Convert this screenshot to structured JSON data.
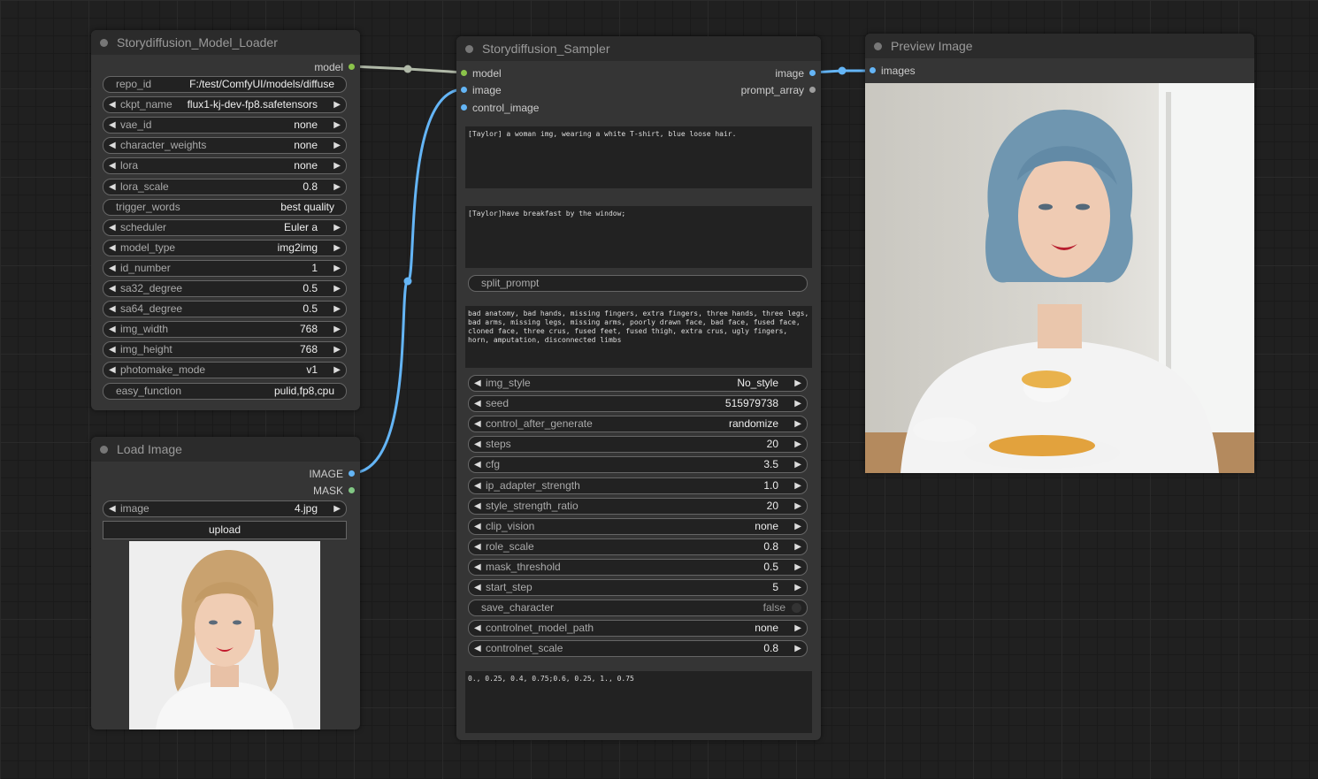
{
  "colors": {
    "canvas_bg": "#202020",
    "node_bg": "#353535",
    "node_title_bg": "#2b2b2b",
    "widget_bg": "#222222",
    "link_image": "#64b5f6",
    "link_model": "#b0b9a8",
    "slot_model": "#8bc34a",
    "slot_image": "#64b5f6",
    "slot_mask": "#81c784",
    "slot_string": "#9e9e9e"
  },
  "model_loader": {
    "title": "Storydiffusion_Model_Loader",
    "output": "model",
    "widgets": [
      {
        "label": "repo_id",
        "value": "F:/test/ComfyUI/models/diffuse",
        "kind": "text"
      },
      {
        "label": "ckpt_name",
        "value": "flux1-kj-dev-fp8.safetensors",
        "kind": "combo"
      },
      {
        "label": "vae_id",
        "value": "none",
        "kind": "combo"
      },
      {
        "label": "character_weights",
        "value": "none",
        "kind": "combo"
      },
      {
        "label": "lora",
        "value": "none",
        "kind": "combo"
      },
      {
        "label": "lora_scale",
        "value": "0.8",
        "kind": "combo"
      },
      {
        "label": "trigger_words",
        "value": "best quality",
        "kind": "text"
      },
      {
        "label": "scheduler",
        "value": "Euler a",
        "kind": "combo"
      },
      {
        "label": "model_type",
        "value": "img2img",
        "kind": "combo"
      },
      {
        "label": "id_number",
        "value": "1",
        "kind": "combo"
      },
      {
        "label": "sa32_degree",
        "value": "0.5",
        "kind": "combo"
      },
      {
        "label": "sa64_degree",
        "value": "0.5",
        "kind": "combo"
      },
      {
        "label": "img_width",
        "value": "768",
        "kind": "combo"
      },
      {
        "label": "img_height",
        "value": "768",
        "kind": "combo"
      },
      {
        "label": "photomake_mode",
        "value": "v1",
        "kind": "combo"
      },
      {
        "label": "easy_function",
        "value": "pulid,fp8,cpu",
        "kind": "text"
      }
    ]
  },
  "load_image": {
    "title": "Load Image",
    "outputs": [
      "IMAGE",
      "MASK"
    ],
    "image_widget": {
      "label": "image",
      "value": "4.jpg"
    },
    "upload_label": "upload"
  },
  "sampler": {
    "title": "Storydiffusion_Sampler",
    "inputs": [
      "model",
      "image",
      "control_image"
    ],
    "outputs": [
      "image",
      "prompt_array"
    ],
    "character_prompt": "[Taylor] a woman img, wearing a white T-shirt, blue loose hair.",
    "scene_prompt": "[Taylor]have breakfast by the window;",
    "split_prompt_placeholder": "split_prompt",
    "negative_prompt": "bad anatomy, bad hands, missing fingers, extra fingers, three hands, three legs, bad arms, missing legs, missing arms, poorly drawn face, bad face, fused face, cloned face, three crus, fused feet, fused thigh, extra crus, ugly fingers, horn, amputation, disconnected limbs",
    "widgets": [
      {
        "label": "img_style",
        "value": "No_style",
        "kind": "combo"
      },
      {
        "label": "seed",
        "value": "515979738",
        "kind": "combo"
      },
      {
        "label": "control_after_generate",
        "value": "randomize",
        "kind": "combo"
      },
      {
        "label": "steps",
        "value": "20",
        "kind": "combo"
      },
      {
        "label": "cfg",
        "value": "3.5",
        "kind": "combo"
      },
      {
        "label": "ip_adapter_strength",
        "value": "1.0",
        "kind": "combo"
      },
      {
        "label": "style_strength_ratio",
        "value": "20",
        "kind": "combo"
      },
      {
        "label": "clip_vision",
        "value": "none",
        "kind": "combo"
      },
      {
        "label": "role_scale",
        "value": "0.8",
        "kind": "combo"
      },
      {
        "label": "mask_threshold",
        "value": "0.5",
        "kind": "combo"
      },
      {
        "label": "start_step",
        "value": "5",
        "kind": "combo"
      },
      {
        "label": "save_character",
        "value": "false",
        "kind": "toggle"
      },
      {
        "label": "controlnet_model_path",
        "value": "none",
        "kind": "combo"
      },
      {
        "label": "controlnet_scale",
        "value": "0.8",
        "kind": "combo"
      }
    ],
    "guidance_list": "0., 0.25, 0.4, 0.75;0.6, 0.25, 1., 0.75"
  },
  "preview": {
    "title": "Preview Image",
    "input": "images"
  }
}
